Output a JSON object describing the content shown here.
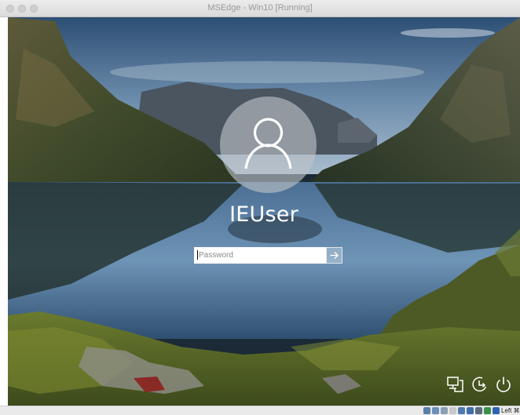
{
  "window": {
    "title": "MSEdge - Win10 [Running]"
  },
  "login": {
    "username": "IEUser",
    "password_placeholder": "Password",
    "password_value": ""
  },
  "icons": {
    "avatar": "user-silhouette-icon",
    "submit": "arrow-right-icon",
    "network": "network-icon",
    "accessibility": "ease-of-access-icon",
    "power": "power-icon"
  },
  "statusbar": {
    "host_key": "Left ⌘",
    "icons": [
      "hard-disk-icon",
      "optical-drive-icon",
      "usb-icon",
      "shared-folders-icon",
      "display-icon",
      "network-adapter-icon",
      "recording-icon",
      "cpu-icon",
      "mouse-integration-icon"
    ]
  },
  "colors": {
    "title_text": "#9a9a9a",
    "username_text": "#ffffff",
    "input_background": "#ffffff"
  }
}
